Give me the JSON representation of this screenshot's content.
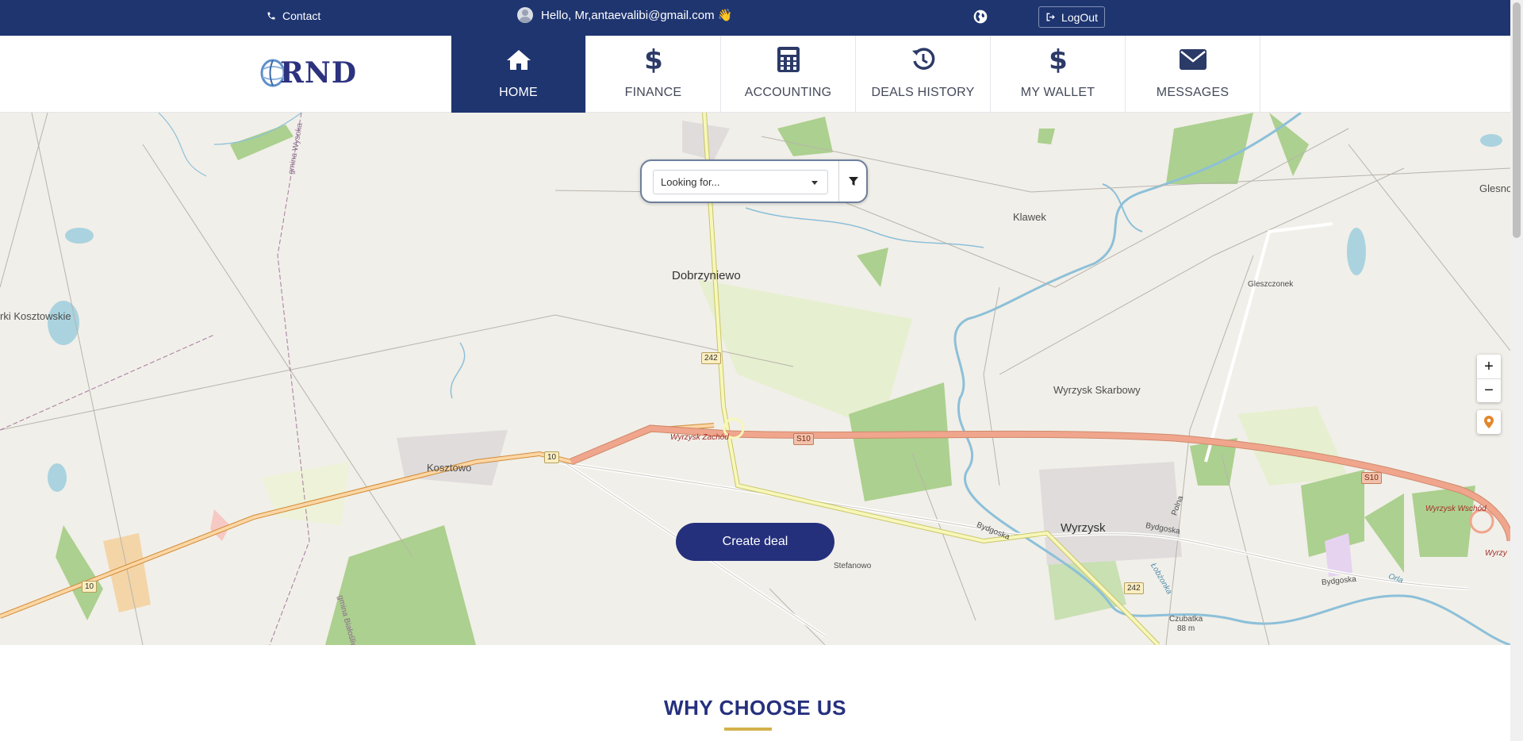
{
  "topbar": {
    "contact_label": "Contact",
    "greeting": "Hello, Mr,antaevalibi@gmail.com 👋",
    "logout_label": "LogOut"
  },
  "brand": {
    "logo_text": "RND"
  },
  "nav": {
    "items": [
      {
        "label": "HOME",
        "icon": "home-icon",
        "active": true
      },
      {
        "label": "FINANCE",
        "icon": "dollar-icon",
        "active": false
      },
      {
        "label": "ACCOUNTING",
        "icon": "calculator-icon",
        "active": false
      },
      {
        "label": "DEALS HISTORY",
        "icon": "history-icon",
        "active": false
      },
      {
        "label": "MY WALLET",
        "icon": "dollar-icon",
        "active": false
      },
      {
        "label": "MESSAGES",
        "icon": "envelope-icon",
        "active": false
      }
    ]
  },
  "search": {
    "placeholder": "Looking for..."
  },
  "map": {
    "places": [
      "Dobrzyniewo",
      "Klawek",
      "Glesno",
      "Gleszczonek",
      "rki Kosztowskie",
      "Wyrzysk Skarbowy",
      "Kosztowo",
      "Wyrzysk",
      "Stefanowo",
      "Czubatka",
      "88 m",
      "Wyrzysk Zachód",
      "Wyrzysk Wschód",
      "Bydgoska",
      "Bydgoska",
      "Bydgoska",
      "Łobżonka",
      "Orla",
      "Polna",
      "gmina Wysoka",
      "gmina Białośliwie",
      "Wyrzy"
    ],
    "roads": [
      "242",
      "S10",
      "10",
      "10",
      "S10",
      "242"
    ],
    "zoom_in": "+",
    "zoom_out": "−"
  },
  "cta": {
    "create_deal": "Create deal"
  },
  "section": {
    "title": "WHY CHOOSE US"
  },
  "colors": {
    "primary": "#1e3570",
    "button": "#25307d",
    "accent": "#d4b24c"
  }
}
